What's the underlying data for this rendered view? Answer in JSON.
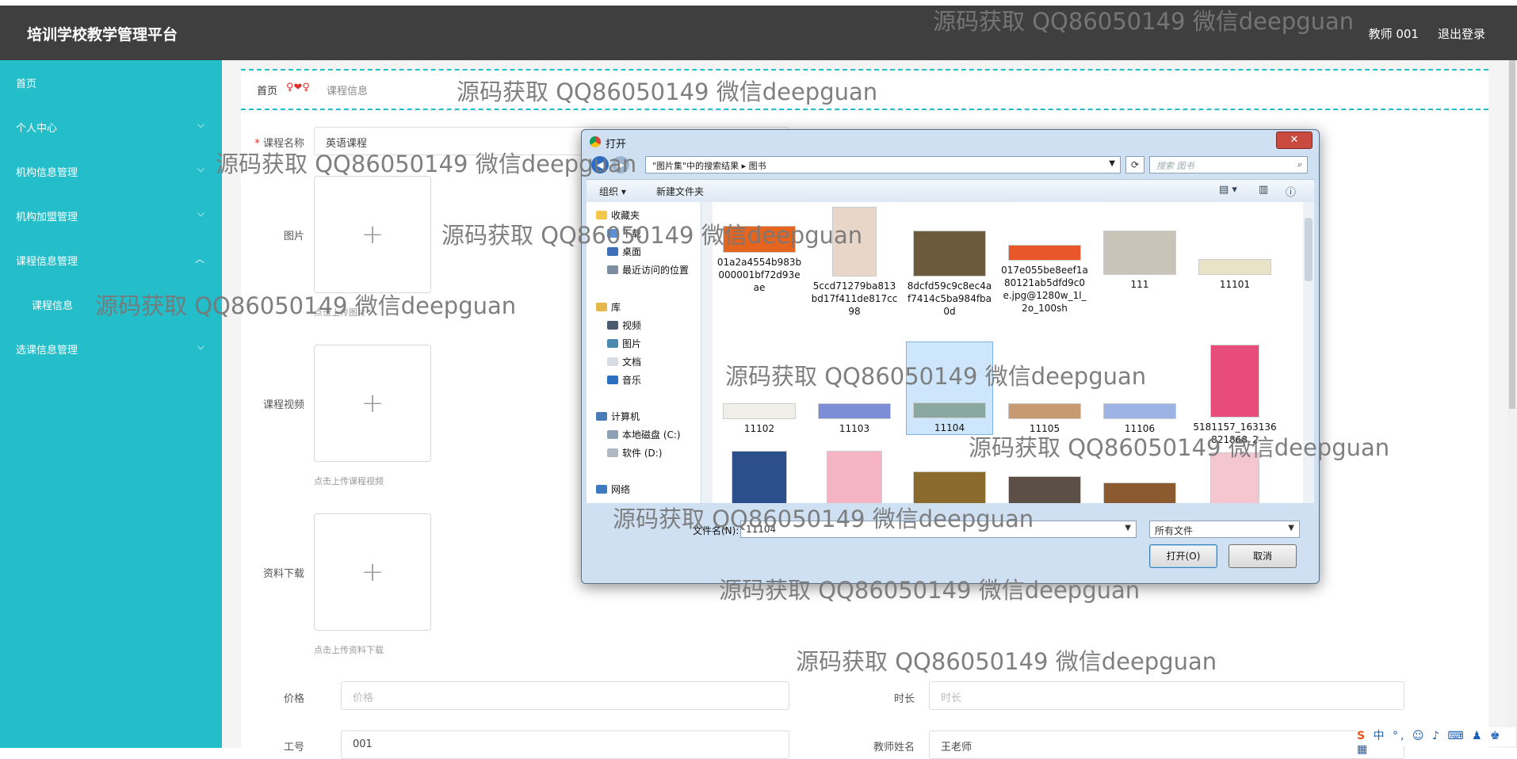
{
  "app": {
    "title": "培训学校教学管理平台",
    "user": "教师 001",
    "logout": "退出登录"
  },
  "sidebar": {
    "items": [
      {
        "label": "首页"
      },
      {
        "label": "个人中心"
      },
      {
        "label": "机构信息管理"
      },
      {
        "label": "机构加盟管理"
      },
      {
        "label": "课程信息管理"
      },
      {
        "label": "课程信息"
      },
      {
        "label": "选课信息管理"
      }
    ]
  },
  "breadcrumb": {
    "home": "首页",
    "sep": "♀❤♀",
    "current": "课程信息"
  },
  "form": {
    "course_name_label": "课程名称",
    "course_name_value": "英语课程",
    "image_label": "图片",
    "image_hint": "点击上传图片",
    "video_label": "课程视频",
    "video_hint": "点击上传课程视频",
    "material_label": "资料下载",
    "material_hint": "点击上传资料下载",
    "price_label": "价格",
    "price_placeholder": "价格",
    "duration_label": "时长",
    "duration_placeholder": "时长",
    "job_no_label": "工号",
    "job_no_value": "001",
    "teacher_label": "教师姓名",
    "teacher_value": "王老师",
    "plus": "+"
  },
  "dialog": {
    "title": "打开",
    "close": "✕",
    "address": "\"图片集\"中的搜索结果 ▸ 图书",
    "search_placeholder": "搜索 图书",
    "organize": "组织 ▾",
    "new_folder": "新建文件夹",
    "tree": {
      "favorites": "收藏夹",
      "downloads": "下载",
      "desktop": "桌面",
      "recent": "最近访问的位置",
      "libraries": "库",
      "videos": "视频",
      "pictures": "图片",
      "documents": "文档",
      "music": "音乐",
      "computer": "计算机",
      "disk_c": "本地磁盘 (C:)",
      "disk_d": "软件 (D:)",
      "network": "网络"
    },
    "files": [
      {
        "name": "01a2a4554b983b000001bf72d93eae",
        "color": "#e5641e"
      },
      {
        "name": "5ccd71279ba813bd17f411de817cc98",
        "color": "#e8d6c8"
      },
      {
        "name": "8dcfd59c9c8ec4af7414c5ba984fba0d",
        "color": "#6b5a3c"
      },
      {
        "name": "017e055be8eef1a80121ab5dfd9c0e.jpg@1280w_1l_2o_100sh",
        "color": "#e9562a"
      },
      {
        "name": "111",
        "color": "#c9c4b8"
      },
      {
        "name": "11101",
        "color": "#e8e2c6"
      },
      {
        "name": "11102",
        "color": "#f1efe9"
      },
      {
        "name": "11103",
        "color": "#7d8dd6"
      },
      {
        "name": "11104",
        "color": "#8ba8a0"
      },
      {
        "name": "11105",
        "color": "#c79a72"
      },
      {
        "name": "11106",
        "color": "#9db3e6"
      },
      {
        "name": "5181157_163136821868_2",
        "color": "#e84c7a"
      },
      {
        "name": "",
        "color": "#2c4f8c"
      },
      {
        "name": "",
        "color": "#f4b4c4"
      },
      {
        "name": "",
        "color": "#8b6a2e"
      },
      {
        "name": "",
        "color": "#5c5046"
      },
      {
        "name": "",
        "color": "#8b5a2e"
      },
      {
        "name": "",
        "color": "#f4c6d0"
      }
    ],
    "filename_label": "文件名(N):",
    "filename_value": "11104",
    "filetype": "所有文件",
    "open_btn": "打开(O)",
    "cancel_btn": "取消"
  },
  "watermark": "源码获取 QQ86050149 微信deepguan",
  "ime": {
    "logo": "S",
    "text": "中 °, ☺ ♪ ⌨ ♟ ♚ ▦"
  }
}
